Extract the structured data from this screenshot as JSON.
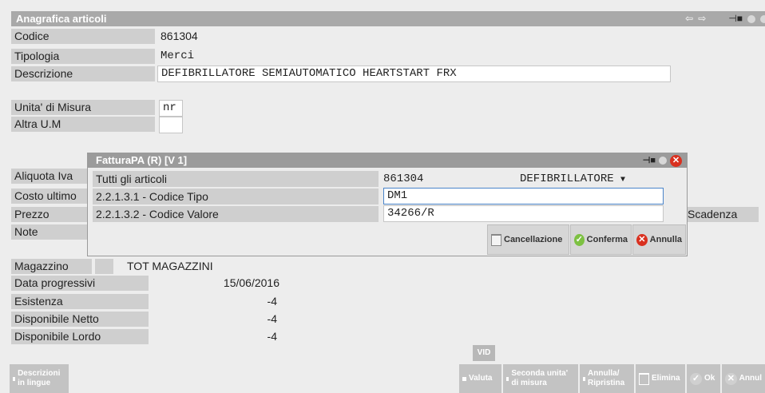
{
  "window": {
    "title": "Anagrafica articoli"
  },
  "form": {
    "codice": {
      "label": "Codice",
      "value": "861304"
    },
    "tipologia": {
      "label": "Tipologia",
      "value": "Merci"
    },
    "descrizione": {
      "label": "Descrizione",
      "value": "DEFIBRILLATORE SEMIAUTOMATICO HEARTSTART FRX"
    },
    "um": {
      "label": "Unita' di Misura",
      "value": "nr"
    },
    "altra_um": {
      "label": "Altra U.M",
      "value": ""
    },
    "aliquota": {
      "label": "Aliquota Iva"
    },
    "costo": {
      "label": "Costo ultimo"
    },
    "prezzo": {
      "label": "Prezzo"
    },
    "note": {
      "label": "Note"
    },
    "scadenza": {
      "label": "Scadenza"
    }
  },
  "dialog": {
    "title": "FatturaPA (R) [V 1]",
    "rows": [
      {
        "label": "Tutti gli articoli",
        "value": "861304",
        "extra": "DEFIBRILLATORE"
      },
      {
        "label": "2.2.1.3.1 - Codice Tipo",
        "value": "DM1"
      },
      {
        "label": "2.2.1.3.2 - Codice Valore",
        "value": "34266/R"
      }
    ],
    "buttons": {
      "cancel": "Cancellazione",
      "confirm": "Conferma",
      "annulla": "Annulla"
    }
  },
  "stock": {
    "magazzino": {
      "label": "Magazzino",
      "value": "TOT MAGAZZINI"
    },
    "data": {
      "label": "Data progressivi",
      "value": "15/06/2016"
    },
    "esistenza": {
      "label": "Esistenza",
      "value": "-4"
    },
    "disp_netto": {
      "label": "Disponibile Netto",
      "value": "-4"
    },
    "disp_lordo": {
      "label": "Disponibile Lordo",
      "value": "-4"
    }
  },
  "toolbar": {
    "vid": "VID",
    "descrizioni": "Descrizioni in lingue",
    "valuta": "Valuta",
    "seconda": "Seconda unita' di misura",
    "annulla_ripristina": "Annulla/ Ripristina",
    "elimina": "Elimina",
    "ok": "Ok",
    "annul": "Annul"
  }
}
